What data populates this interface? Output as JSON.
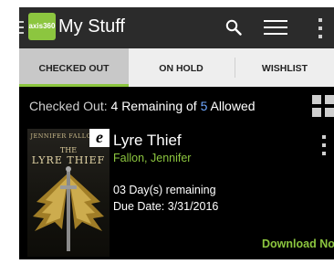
{
  "app": {
    "logo_text": "axis360",
    "title": "My Stuff",
    "accent_color": "#8cc63f",
    "icons": [
      "menu-icon",
      "search-icon",
      "list-view-icon",
      "overflow-menu-icon"
    ]
  },
  "tabs": [
    {
      "label": "CHECKED OUT",
      "active": true
    },
    {
      "label": "ON HOLD",
      "active": false
    },
    {
      "label": "WISHLIST",
      "active": false
    }
  ],
  "summary": {
    "label": "Checked Out:",
    "remaining": "4",
    "middle": "Remaining of",
    "allowed": "5",
    "tail": "Allowed"
  },
  "book": {
    "cover_author": "JENNIFER FALLON",
    "cover_the": "THE",
    "cover_title": "LYRE THIEF",
    "format_badge": "e",
    "title": "Lyre Thief",
    "author": "Fallon, Jennifer",
    "remaining": "03 Day(s) remaining",
    "due_date": "Due Date: 3/31/2016",
    "action": "Download Now"
  }
}
